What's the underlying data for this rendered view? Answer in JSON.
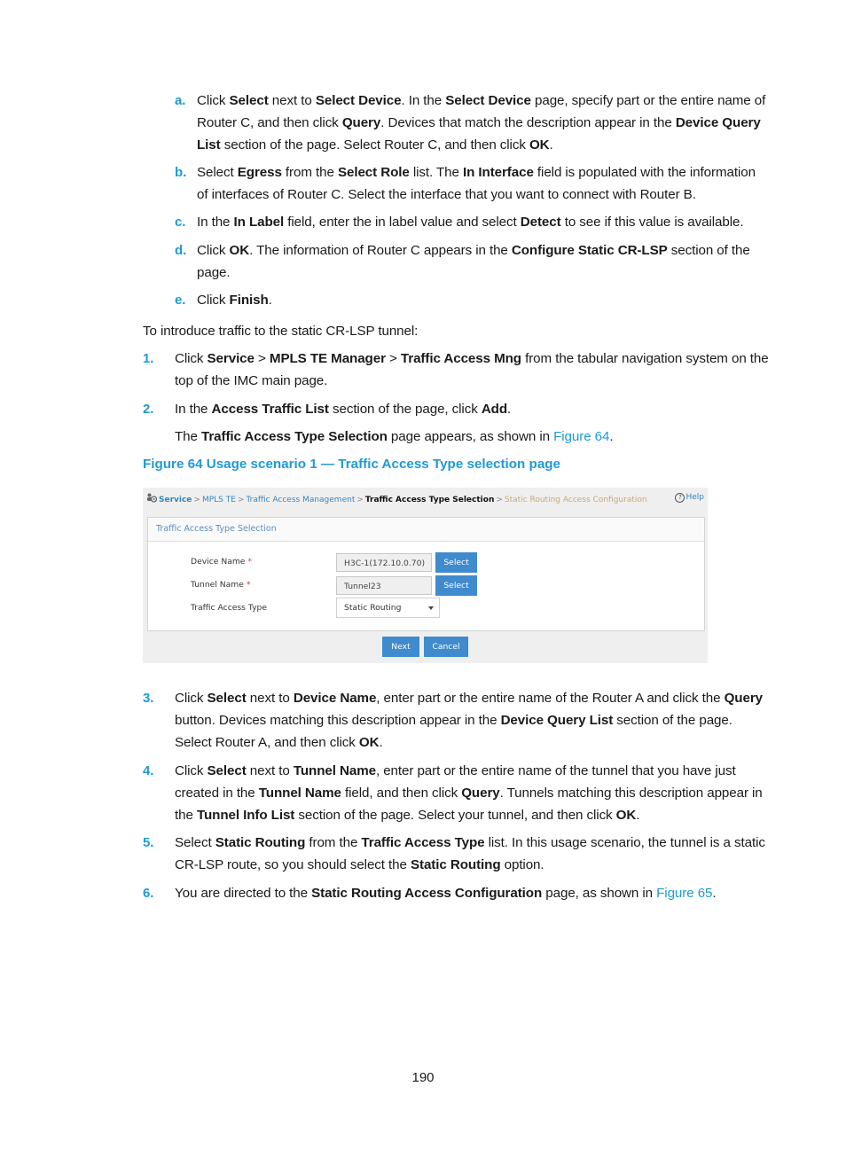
{
  "substeps": [
    {
      "marker": "a.",
      "segments": [
        [
          "Click ",
          false
        ],
        [
          "Select",
          true
        ],
        [
          " next to ",
          false
        ],
        [
          "Select Device",
          true
        ],
        [
          ". In the ",
          false
        ],
        [
          "Select Device",
          true
        ],
        [
          " page, specify part or the entire name of Router C, and then click ",
          false
        ],
        [
          "Query",
          true
        ],
        [
          ". Devices that match the description appear in the ",
          false
        ],
        [
          "Device Query List",
          true
        ],
        [
          " section of the page. Select Router C, and then click ",
          false
        ],
        [
          "OK",
          true
        ],
        [
          ".",
          false
        ]
      ]
    },
    {
      "marker": "b.",
      "segments": [
        [
          "Select ",
          false
        ],
        [
          "Egress",
          true
        ],
        [
          " from the ",
          false
        ],
        [
          "Select Role",
          true
        ],
        [
          " list. The ",
          false
        ],
        [
          "In Interface",
          true
        ],
        [
          " field is populated with the information of interfaces of Router C. Select the interface that you want to connect with Router B.",
          false
        ]
      ]
    },
    {
      "marker": "c.",
      "segments": [
        [
          "In the ",
          false
        ],
        [
          "In Label",
          true
        ],
        [
          " field, enter the in label value and select ",
          false
        ],
        [
          "Detect",
          true
        ],
        [
          " to see if this value is available.",
          false
        ]
      ]
    },
    {
      "marker": "d.",
      "segments": [
        [
          "Click ",
          false
        ],
        [
          "OK",
          true
        ],
        [
          ". The information of Router C appears in the ",
          false
        ],
        [
          "Configure Static CR-LSP",
          true
        ],
        [
          " section of the page.",
          false
        ]
      ]
    },
    {
      "marker": "e.",
      "segments": [
        [
          "Click ",
          false
        ],
        [
          "Finish",
          true
        ],
        [
          ".",
          false
        ]
      ]
    }
  ],
  "intro": "To introduce traffic to the static CR-LSP tunnel:",
  "steps_before": [
    {
      "marker": "1.",
      "segments": [
        [
          "Click ",
          false
        ],
        [
          "Service",
          true
        ],
        [
          " > ",
          false
        ],
        [
          "MPLS TE Manager",
          true
        ],
        [
          " > ",
          false
        ],
        [
          "Traffic Access Mng",
          true
        ],
        [
          " from the tabular navigation system on the top of the IMC main page.",
          false
        ]
      ]
    },
    {
      "marker": "2.",
      "segments": [
        [
          "In the ",
          false
        ],
        [
          "Access Traffic List",
          true
        ],
        [
          " section of the page, click ",
          false
        ],
        [
          "Add",
          true
        ],
        [
          ".",
          false
        ]
      ]
    }
  ],
  "step2_followup": {
    "segments": [
      [
        "The ",
        false
      ],
      [
        "Traffic Access Type Selection",
        true
      ],
      [
        " page appears, as shown in ",
        false
      ]
    ],
    "link": "Figure 64",
    "end": "."
  },
  "figure_caption": "Figure 64 Usage scenario 1 — Traffic Access Type selection page",
  "screenshot": {
    "breadcrumb": {
      "service": "Service",
      "mpls_te": "MPLS TE",
      "traffic_access_mgmt": "Traffic Access Management",
      "current": "Traffic Access Type Selection",
      "next": "Static Routing Access Configuration",
      "separator": ">"
    },
    "help_label": "Help",
    "panel_title": "Traffic Access Type Selection",
    "fields": {
      "device_name_label": "Device Name",
      "device_name_value": "H3C-1(172.10.0.70)",
      "tunnel_name_label": "Tunnel Name",
      "tunnel_name_value": "Tunnel23",
      "traffic_access_type_label": "Traffic Access Type",
      "traffic_access_type_value": "Static Routing",
      "required_mark": "*"
    },
    "select_label": "Select",
    "next_label": "Next",
    "cancel_label": "Cancel"
  },
  "steps_after": [
    {
      "marker": "3.",
      "segments": [
        [
          "Click ",
          false
        ],
        [
          "Select",
          true
        ],
        [
          " next to ",
          false
        ],
        [
          "Device Name",
          true
        ],
        [
          ", enter part or the entire name of the Router A and click the ",
          false
        ],
        [
          "Query",
          true
        ],
        [
          " button. Devices matching this description appear in the ",
          false
        ],
        [
          "Device Query List",
          true
        ],
        [
          " section of the page. Select Router A, and then click ",
          false
        ],
        [
          "OK",
          true
        ],
        [
          ".",
          false
        ]
      ]
    },
    {
      "marker": "4.",
      "segments": [
        [
          "Click ",
          false
        ],
        [
          "Select",
          true
        ],
        [
          " next to ",
          false
        ],
        [
          "Tunnel Name",
          true
        ],
        [
          ", enter part or the entire name of the tunnel that you have just created in the ",
          false
        ],
        [
          "Tunnel Name",
          true
        ],
        [
          " field, and then click ",
          false
        ],
        [
          "Query",
          true
        ],
        [
          ". Tunnels matching this description appear in the ",
          false
        ],
        [
          "Tunnel Info List",
          true
        ],
        [
          " section of the page. Select your tunnel, and then click ",
          false
        ],
        [
          "OK",
          true
        ],
        [
          ".",
          false
        ]
      ]
    },
    {
      "marker": "5.",
      "segments": [
        [
          "Select ",
          false
        ],
        [
          "Static Routing",
          true
        ],
        [
          " from the ",
          false
        ],
        [
          "Traffic Access Type",
          true
        ],
        [
          " list. In this usage scenario, the tunnel is a static CR-LSP route, so you should select the ",
          false
        ],
        [
          "Static Routing",
          true
        ],
        [
          " option.",
          false
        ]
      ]
    },
    {
      "marker": "6.",
      "segments": [
        [
          "You are directed to the ",
          false
        ],
        [
          "Static Routing Access Configuration",
          true
        ],
        [
          " page, as shown in ",
          false
        ]
      ],
      "link": "Figure 65",
      "end": "."
    }
  ],
  "page_number": "190"
}
